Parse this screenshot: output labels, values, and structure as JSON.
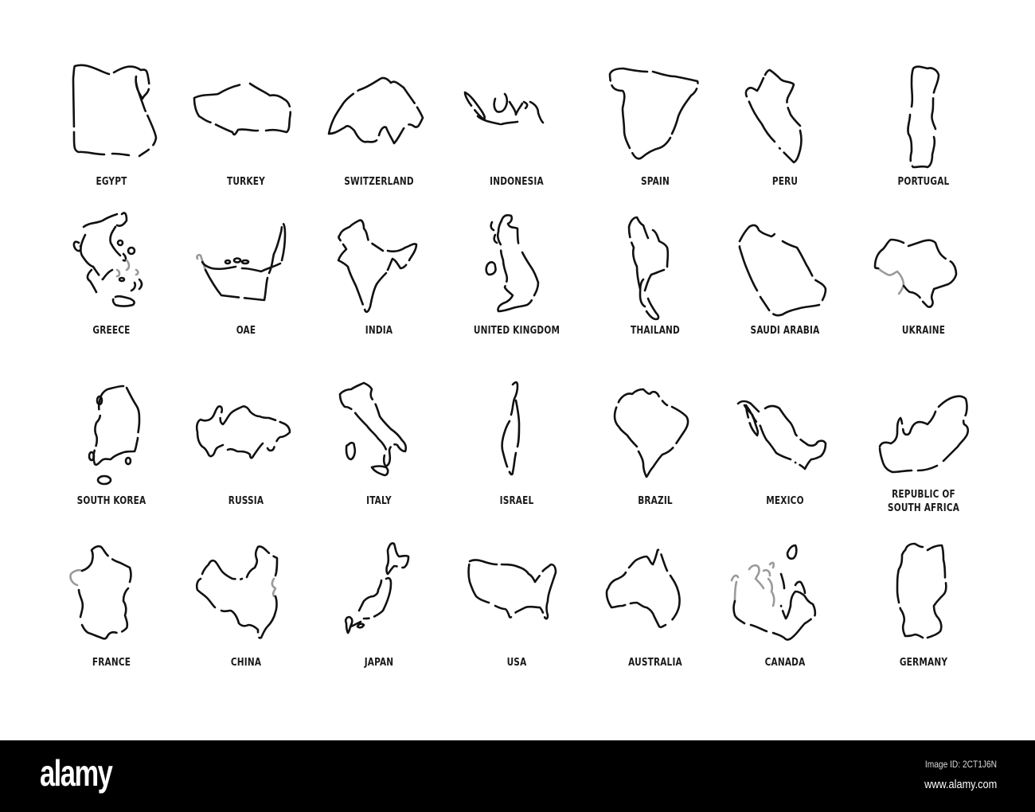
{
  "countries": [
    {
      "name": "EGYPT",
      "icon": "egypt-outline-icon"
    },
    {
      "name": "TURKEY",
      "icon": "turkey-outline-icon"
    },
    {
      "name": "SWITZERLAND",
      "icon": "switzerland-outline-icon"
    },
    {
      "name": "INDONESIA",
      "icon": "indonesia-outline-icon"
    },
    {
      "name": "SPAIN",
      "icon": "spain-outline-icon"
    },
    {
      "name": "PERU",
      "icon": "peru-outline-icon"
    },
    {
      "name": "PORTUGAL",
      "icon": "portugal-outline-icon"
    },
    {
      "name": "GREECE",
      "icon": "greece-outline-icon"
    },
    {
      "name": "OAE",
      "icon": "uae-outline-icon"
    },
    {
      "name": "INDIA",
      "icon": "india-outline-icon"
    },
    {
      "name": "UNITED KINGDOM",
      "icon": "uk-outline-icon"
    },
    {
      "name": "THAILAND",
      "icon": "thailand-outline-icon"
    },
    {
      "name": "SAUDI ARABIA",
      "icon": "saudi-arabia-outline-icon"
    },
    {
      "name": "UKRAINE",
      "icon": "ukraine-outline-icon"
    },
    {
      "name": "SOUTH KOREA",
      "icon": "south-korea-outline-icon"
    },
    {
      "name": "RUSSIA",
      "icon": "russia-outline-icon"
    },
    {
      "name": "ITALY",
      "icon": "italy-outline-icon"
    },
    {
      "name": "ISRAEL",
      "icon": "israel-outline-icon"
    },
    {
      "name": "BRAZIL",
      "icon": "brazil-outline-icon"
    },
    {
      "name": "MEXICO",
      "icon": "mexico-outline-icon"
    },
    {
      "name": "REPUBLIC OF\nSOUTH AFRICA",
      "icon": "south-africa-outline-icon"
    },
    {
      "name": "FRANCE",
      "icon": "france-outline-icon"
    },
    {
      "name": "CHINA",
      "icon": "china-outline-icon"
    },
    {
      "name": "JAPAN",
      "icon": "japan-outline-icon"
    },
    {
      "name": "USA",
      "icon": "usa-outline-icon"
    },
    {
      "name": "AUSTRALIA",
      "icon": "australia-outline-icon"
    },
    {
      "name": "CANADA",
      "icon": "canada-outline-icon"
    },
    {
      "name": "GERMANY",
      "icon": "germany-outline-icon"
    }
  ],
  "footer": {
    "logo": "alamy",
    "image_id": "Image ID: 2CT1J6N",
    "website": "www.alamy.com"
  },
  "colors": {
    "background": "#ffffff",
    "stroke": "#111111",
    "footer_bg": "#000000"
  }
}
